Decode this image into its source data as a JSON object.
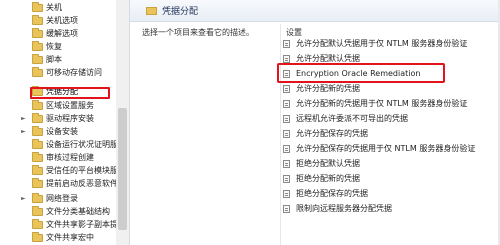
{
  "tree": {
    "items": [
      {
        "label": "关机"
      },
      {
        "label": "关机选项"
      },
      {
        "label": "缓解选项"
      },
      {
        "label": "恢复"
      },
      {
        "label": "脚本"
      },
      {
        "label": "可移动存储访问"
      },
      {
        "label": "凭据分配",
        "selected": true
      },
      {
        "label": "区域设置服务"
      },
      {
        "label": "驱动程序安装"
      },
      {
        "label": "设备安装"
      },
      {
        "label": "设备运行状况证明服"
      },
      {
        "label": "审核过程创建"
      },
      {
        "label": "受信任的平台模块服"
      },
      {
        "label": "提前启动反恶意软件"
      },
      {
        "label": "网络登录"
      },
      {
        "label": "文件分类基础结构"
      },
      {
        "label": "文件共享影子副本提"
      },
      {
        "label": "文件共享宏中"
      }
    ]
  },
  "header": {
    "title": "凭据分配"
  },
  "description": "选择一个项目来查看它的描述。",
  "settings": {
    "heading": "设置",
    "items": [
      {
        "label": "允许分配默认凭据用于仅 NTLM 服务器身份验证"
      },
      {
        "label": "允许分配默认凭据"
      },
      {
        "label": "Encryption Oracle Remediation"
      },
      {
        "label": "允许分配新的凭据"
      },
      {
        "label": "允许分配新的凭据用于仅 NTLM 服务器身份验证"
      },
      {
        "label": "远程机允许委派不可导出的凭据"
      },
      {
        "label": "允许分配保存的凭据"
      },
      {
        "label": "允许分配保存的凭据用于仅 NTLM 服务器身份验证"
      },
      {
        "label": "拒绝分配默认凭据"
      },
      {
        "label": "拒绝分配新的凭据"
      },
      {
        "label": "拒绝分配保存的凭据"
      },
      {
        "label": "限制向远程服务器分配凭据"
      }
    ]
  },
  "colors": {
    "highlight": "#e0141a",
    "folder": "#e8c45a"
  }
}
